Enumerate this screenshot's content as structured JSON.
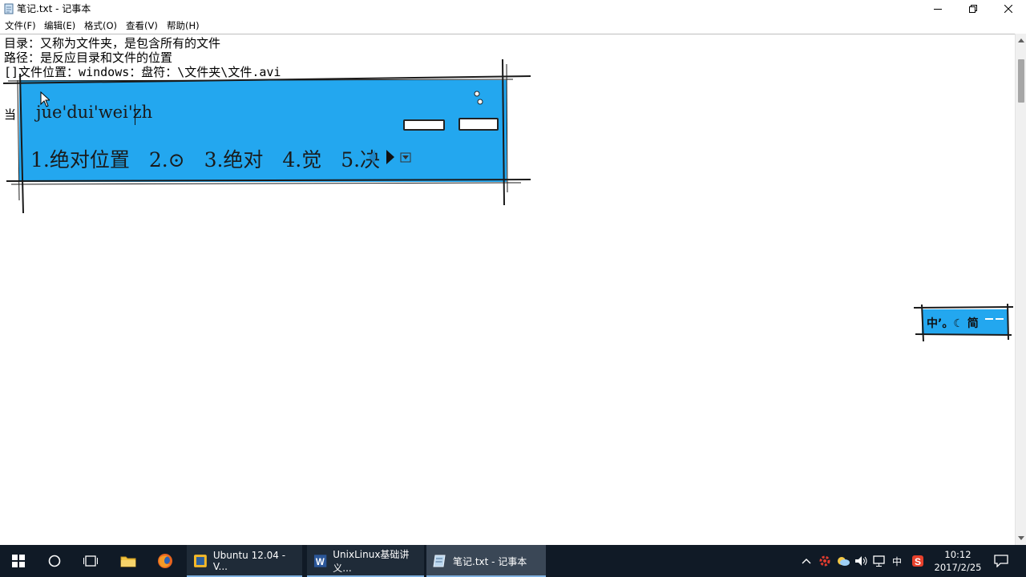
{
  "window": {
    "title": "笔记.txt - 记事本"
  },
  "menu": [
    {
      "label": "文件(F)"
    },
    {
      "label": "编辑(E)"
    },
    {
      "label": "格式(O)"
    },
    {
      "label": "查看(V)"
    },
    {
      "label": "帮助(H)"
    }
  ],
  "document": {
    "lines": [
      "目录：又称为文件夹，是包含所有的文件",
      "路径：是反应目录和文件的位置",
      "[]文件位置：windows：盘符：\\文件夹\\文件.avi",
      "当"
    ]
  },
  "ime": {
    "composition": "jue'dui'wei'zh",
    "candidates": [
      "1.绝对位置",
      "2.⊙",
      "3.绝对",
      "4.觉",
      "5.决"
    ],
    "status": "中’。☾ 简",
    "color": "#23a7ef"
  },
  "taskbar": {
    "tasks": [
      {
        "label": "Ubuntu 12.04 - V..."
      },
      {
        "label": "UnixLinux基础讲义..."
      },
      {
        "label": "笔记.txt - 记事本"
      }
    ],
    "ime_indicator": "中",
    "time": "10:12",
    "date": "2017/2/25",
    "color": "#101a26"
  }
}
